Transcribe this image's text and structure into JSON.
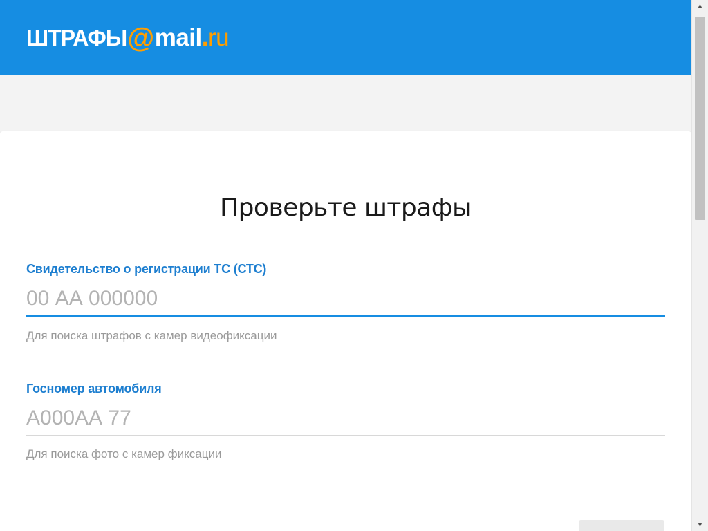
{
  "header": {
    "logo": {
      "shtrafy": "ШТРАФЫ",
      "at": "@",
      "mail": "mail",
      "dot": ".",
      "ru": "ru"
    },
    "colors": {
      "background": "#168de2",
      "accent": "#ff9e00"
    }
  },
  "form": {
    "title": "Проверьте штрафы",
    "sts": {
      "label": "Свидетельство о регистрации ТС (СТС)",
      "placeholder": "00 АА 000000",
      "value": "",
      "hint": "Для поиска штрафов с камер видеофиксации"
    },
    "plate": {
      "label": "Госномер автомобиля",
      "placeholder": "А000АА 77",
      "value": "",
      "hint": "Для поиска фото с камер фиксации"
    },
    "submit_label": ""
  },
  "scrollbar": {
    "up_icon": "▲",
    "down_icon": "▼"
  }
}
